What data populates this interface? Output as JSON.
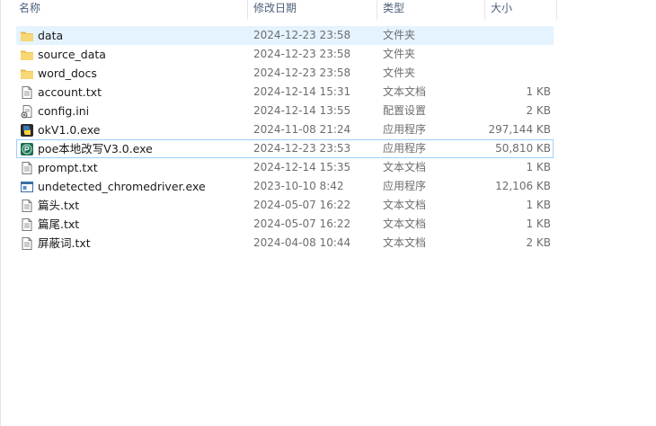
{
  "columns": {
    "name": "名称",
    "date": "修改日期",
    "type": "类型",
    "size": "大小"
  },
  "files": [
    {
      "name": "data",
      "date": "2024-12-23 23:58",
      "type": "文件夹",
      "size": "",
      "icon": "folder-icon"
    },
    {
      "name": "source_data",
      "date": "2024-12-23 23:58",
      "type": "文件夹",
      "size": "",
      "icon": "folder-icon"
    },
    {
      "name": "word_docs",
      "date": "2024-12-23 23:58",
      "type": "文件夹",
      "size": "",
      "icon": "folder-icon"
    },
    {
      "name": "account.txt",
      "date": "2024-12-14 15:31",
      "type": "文本文档",
      "size": "1 KB",
      "icon": "text-file-icon"
    },
    {
      "name": "config.ini",
      "date": "2024-12-14 13:55",
      "type": "配置设置",
      "size": "2 KB",
      "icon": "config-file-icon"
    },
    {
      "name": "okV1.0.exe",
      "date": "2024-11-08 21:24",
      "type": "应用程序",
      "size": "297,144 KB",
      "icon": "python-exe-icon"
    },
    {
      "name": "poe本地改写V3.0.exe",
      "date": "2024-12-23 23:53",
      "type": "应用程序",
      "size": "50,810 KB",
      "icon": "poe-app-icon"
    },
    {
      "name": "prompt.txt",
      "date": "2024-12-14 15:35",
      "type": "文本文档",
      "size": "1 KB",
      "icon": "text-file-icon"
    },
    {
      "name": "undetected_chromedriver.exe",
      "date": "2023-10-10 8:42",
      "type": "应用程序",
      "size": "12,106 KB",
      "icon": "window-exe-icon"
    },
    {
      "name": "篇头.txt",
      "date": "2024-05-07 16:22",
      "type": "文本文档",
      "size": "1 KB",
      "icon": "text-file-icon"
    },
    {
      "name": "篇尾.txt",
      "date": "2024-05-07 16:22",
      "type": "文本文档",
      "size": "1 KB",
      "icon": "text-file-icon"
    },
    {
      "name": "屏蔽词.txt",
      "date": "2024-04-08 10:44",
      "type": "文本文档",
      "size": "2 KB",
      "icon": "text-file-icon"
    }
  ],
  "state": {
    "selected": [
      "data"
    ],
    "focused": [
      "poe本地改写V3.0.exe"
    ]
  },
  "colors": {
    "folder": "#f8d775",
    "selection": "#e5f3ff",
    "focus_border": "#99d1ff",
    "header_text": "#4c607a"
  }
}
